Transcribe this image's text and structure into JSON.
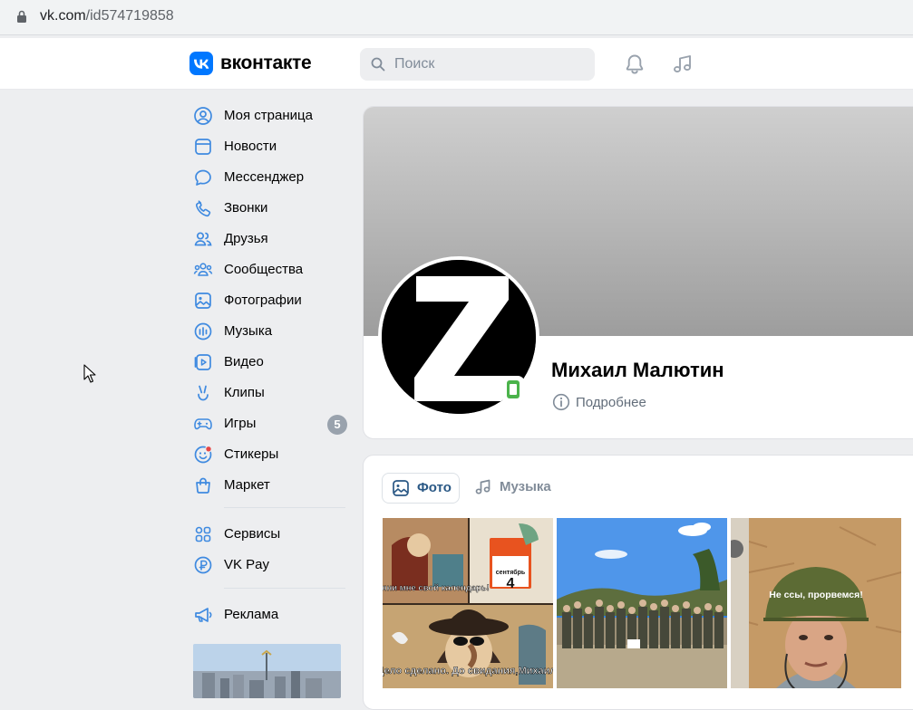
{
  "browser": {
    "url_host": "vk.com",
    "url_path": "/id574719858"
  },
  "header": {
    "brand": "вконтакте",
    "search_placeholder": "Поиск",
    "icons": [
      "bell-icon",
      "music-note-icon"
    ]
  },
  "sidebar": {
    "items": [
      {
        "label": "Моя страница",
        "icon": "user-circle-icon"
      },
      {
        "label": "Новости",
        "icon": "newsfeed-icon"
      },
      {
        "label": "Мессенджер",
        "icon": "message-bubble-icon"
      },
      {
        "label": "Звонки",
        "icon": "phone-icon"
      },
      {
        "label": "Друзья",
        "icon": "friends-icon"
      },
      {
        "label": "Сообщества",
        "icon": "communities-icon"
      },
      {
        "label": "Фотографии",
        "icon": "photo-icon"
      },
      {
        "label": "Музыка",
        "icon": "music-bars-icon"
      },
      {
        "label": "Видео",
        "icon": "video-icon"
      },
      {
        "label": "Клипы",
        "icon": "clips-icon"
      },
      {
        "label": "Игры",
        "icon": "gamepad-icon",
        "badge": "5"
      },
      {
        "label": "Стикеры",
        "icon": "sticker-icon"
      },
      {
        "label": "Маркет",
        "icon": "market-bag-icon"
      }
    ],
    "items2": [
      {
        "label": "Сервисы",
        "icon": "services-grid-icon"
      },
      {
        "label": "VK Pay",
        "icon": "vkpay-icon"
      }
    ],
    "items3": [
      {
        "label": "Реклама",
        "icon": "megaphone-icon"
      }
    ]
  },
  "profile": {
    "name": "Михаил Малютин",
    "more_label": "Подробнее",
    "avatar_letter": "Z"
  },
  "media": {
    "tabs": [
      {
        "label": "Фото",
        "icon": "image-icon",
        "active": true
      },
      {
        "label": "Музыка",
        "icon": "music-note-icon",
        "active": false
      }
    ],
    "photos": [
      {
        "captions": [
          "Протяни мне свой календарь!",
          "Дело сделано. До свидания,Михаил."
        ],
        "calendar_month": "сентябрь",
        "calendar_day": "4"
      },
      {
        "captions": []
      },
      {
        "captions": [
          "Не ссы, прорвемся!"
        ]
      }
    ]
  },
  "colors": {
    "vk_blue": "#0077ff",
    "accent_icon": "#2a5885",
    "badge_gray": "#99a2ad",
    "online_green": "#4bb34b"
  }
}
